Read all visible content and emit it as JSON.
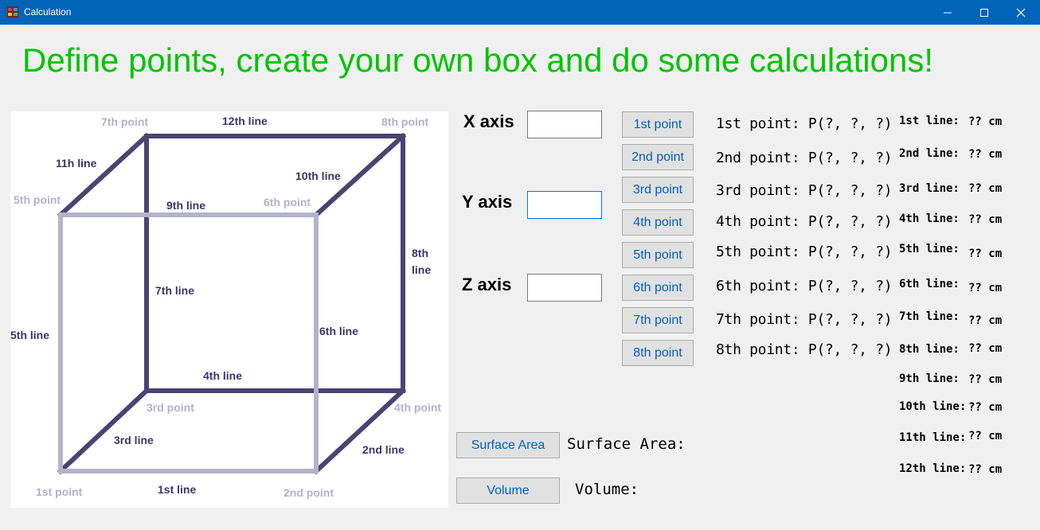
{
  "window": {
    "title": "Calculation"
  },
  "headline": "Define points, create your own box and do some calculations!",
  "diagram": {
    "colors": {
      "back_edges": "#4a4473",
      "front_edges": "#b5b2cc"
    },
    "line_labels": [
      "1st line",
      "2nd line",
      "3rd line",
      "4th line",
      "5th line",
      "6th line",
      "7th line",
      "8th",
      "line",
      "9th line",
      "10th line",
      "11h line",
      "12th line"
    ],
    "point_labels": [
      "1st point",
      "2nd point",
      "3rd point",
      "4th point",
      "5th point",
      "6th point",
      "7th point",
      "8th point"
    ]
  },
  "inputs": {
    "x_label": "X axis",
    "y_label": "Y axis",
    "z_label": "Z axis",
    "x_value": "",
    "y_value": "",
    "z_value": ""
  },
  "point_buttons": [
    "1st point",
    "2nd point",
    "3rd point",
    "4th point",
    "5th point",
    "6th point",
    "7th point",
    "8th point"
  ],
  "point_results": [
    "1st point:  P(?, ?, ?)",
    "2nd point: P(?, ?, ?)",
    "3rd point: P(?, ?, ?)",
    "4th point: P(?, ?, ?)",
    "5th point: P(?, ?, ?)",
    "6th point: P(?, ?, ?)",
    "7th point: P(?, ?, ?)",
    "8th point: P(?, ?, ?)"
  ],
  "line_results": [
    {
      "name": "1st line:",
      "value": "??  cm"
    },
    {
      "name": "2nd line:",
      "value": "??  cm"
    },
    {
      "name": "3rd line:",
      "value": "??  cm"
    },
    {
      "name": "4th line:",
      "value": "??  cm"
    },
    {
      "name": "5th line:",
      "value": "??  cm"
    },
    {
      "name": "6th line:",
      "value": "??  cm"
    },
    {
      "name": "7th line:",
      "value": "??  cm"
    },
    {
      "name": "8th line:",
      "value": "??  cm"
    },
    {
      "name": "9th line:",
      "value": "??  cm"
    },
    {
      "name": "10th line:",
      "value": "??  cm"
    },
    {
      "name": "11th line:",
      "value": "??  cm"
    },
    {
      "name": "12th line:",
      "value": "??  cm"
    }
  ],
  "calc": {
    "surface_button": "Surface Area",
    "surface_label": "Surface Area:",
    "volume_button": "Volume",
    "volume_label": "Volume:"
  }
}
